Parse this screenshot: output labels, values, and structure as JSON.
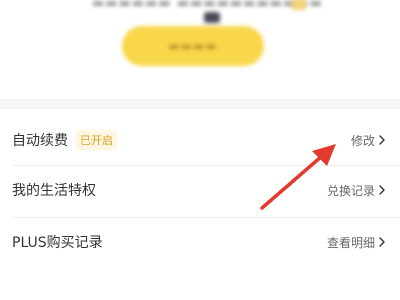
{
  "colors": {
    "accent_yellow": "#f8d74a",
    "tag_text": "#d9a21c",
    "tag_bg": "#fdf6e3",
    "annotation_red": "#e23a2e"
  },
  "top_card": {
    "blurred": true
  },
  "rows": [
    {
      "label": "自动续费",
      "tag": "已开启",
      "action": "修改",
      "icon": "chevron-right-icon"
    },
    {
      "label": "我的生活特权",
      "action": "兑换记录",
      "icon": "chevron-right-icon"
    },
    {
      "label": "PLUS购买记录",
      "action": "查看明细",
      "icon": "chevron-right-icon"
    }
  ],
  "annotation": {
    "type": "red-arrow",
    "points_to": "rows.0.action"
  }
}
